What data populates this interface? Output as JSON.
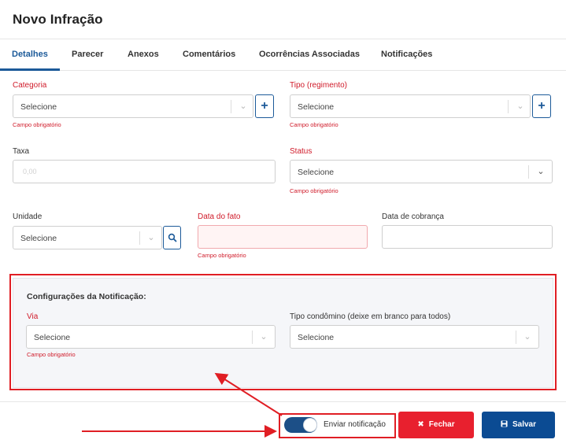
{
  "modal": {
    "title": "Novo Infração"
  },
  "tabs": [
    {
      "label": "Detalhes",
      "active": true
    },
    {
      "label": "Parecer"
    },
    {
      "label": "Anexos"
    },
    {
      "label": "Comentários"
    },
    {
      "label": "Ocorrências Associadas"
    },
    {
      "label": "Notificações"
    }
  ],
  "form": {
    "categoria": {
      "label": "Categoria",
      "placeholder": "Selecione",
      "error": "Campo obrigatório",
      "add_icon": "plus-icon"
    },
    "tipo": {
      "label": "Tipo (regimento)",
      "placeholder": "Selecione",
      "error": "Campo obrigatório",
      "add_icon": "plus-icon"
    },
    "taxa": {
      "label": "Taxa",
      "placeholder": "0,00"
    },
    "status": {
      "label": "Status",
      "placeholder": "Selecione",
      "error": "Campo obrigatório"
    },
    "unidade": {
      "label": "Unidade",
      "placeholder": "Selecione",
      "search_icon": "search-icon"
    },
    "data_fato": {
      "label": "Data do fato",
      "value": "",
      "error": "Campo obrigatório"
    },
    "data_cobranca": {
      "label": "Data de cobrança",
      "value": ""
    }
  },
  "notificacao": {
    "title": "Configurações da Notificação:",
    "via": {
      "label": "Via",
      "placeholder": "Selecione",
      "error": "Campo obrigatório"
    },
    "tipo_condominio": {
      "label": "Tipo condômino (deixe em branco para todos)",
      "placeholder": "Selecione"
    }
  },
  "footer": {
    "toggle": {
      "label": "Enviar notificação",
      "on": true
    },
    "fechar": {
      "label": "Fechar",
      "icon": "close-icon"
    },
    "salvar": {
      "label": "Salvar",
      "icon": "floppy-disk-icon"
    }
  },
  "colors": {
    "primary": "#1c5a99",
    "danger": "#e8202e",
    "save": "#0b4b93",
    "annotation": "#e01e24"
  }
}
